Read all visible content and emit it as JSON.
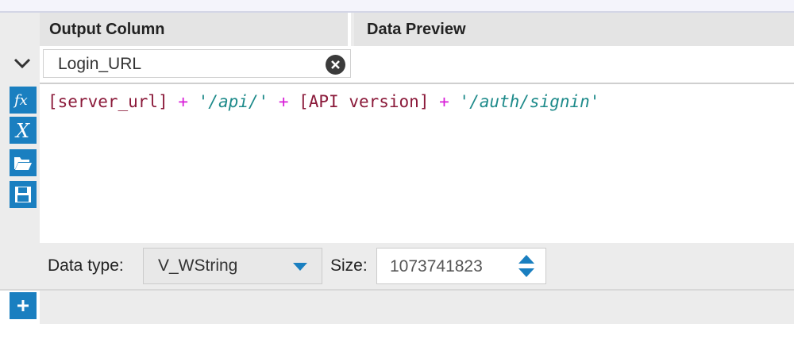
{
  "header": {
    "output_column": "Output Column",
    "data_preview": "Data Preview"
  },
  "row": {
    "output_name": "Login_URL"
  },
  "expression": {
    "tokens": [
      {
        "text": "[server_url]",
        "kind": "field"
      },
      {
        "text": " + ",
        "kind": "op"
      },
      {
        "text": "'/api/'",
        "kind": "string"
      },
      {
        "text": " + ",
        "kind": "op"
      },
      {
        "text": "[API version]",
        "kind": "field"
      },
      {
        "text": " + ",
        "kind": "op"
      },
      {
        "text": "'/auth/signin'",
        "kind": "string"
      }
    ]
  },
  "tools": {
    "function_icon": "function-icon",
    "variable_icon": "variable-icon",
    "open_icon": "folder-open-icon",
    "save_icon": "save-icon"
  },
  "typebar": {
    "data_type_label": "Data type:",
    "data_type_value": "V_WString",
    "size_label": "Size:",
    "size_value": "1073741823"
  },
  "colors": {
    "accent": "#1a7fc0",
    "field": "#8b1a3a",
    "operator": "#d81bd8",
    "string": "#1d8a8a"
  }
}
